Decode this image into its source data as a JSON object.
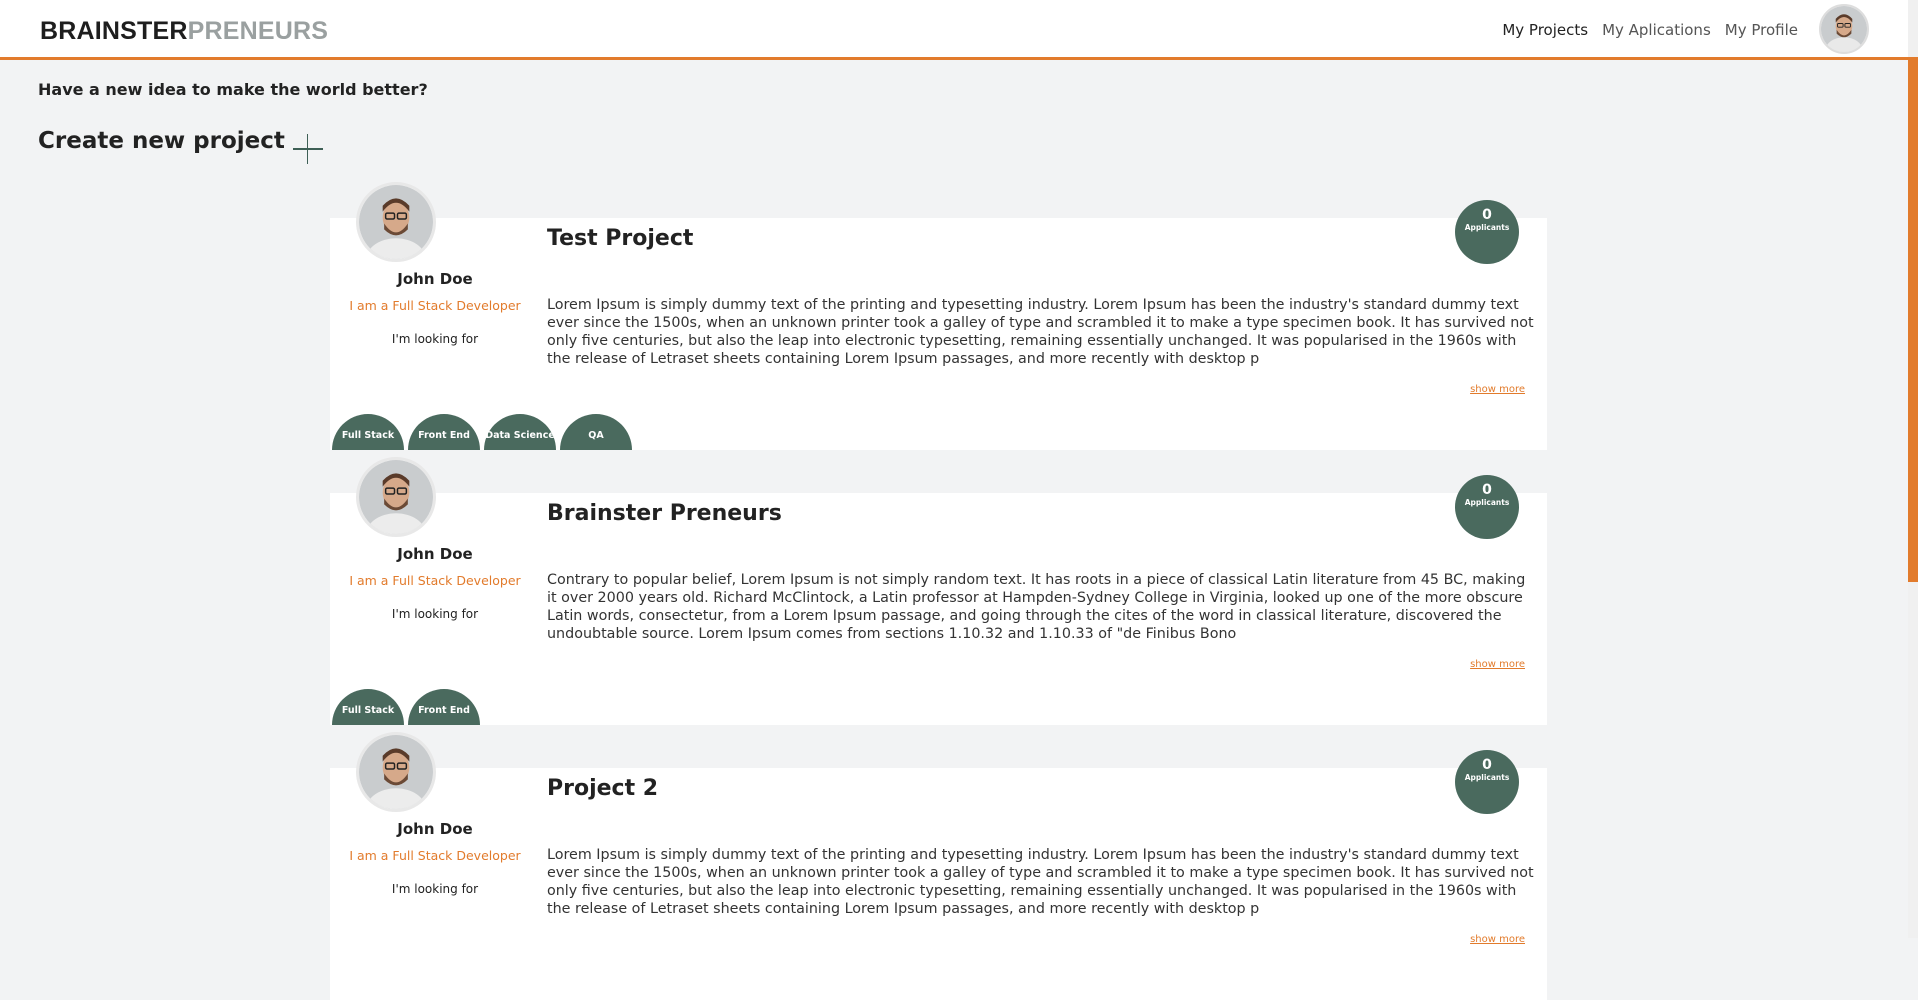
{
  "navbar": {
    "brand_part1": "BRAINSTER",
    "brand_part2": "PRENEURS",
    "links": [
      "My Projects",
      "My Aplications",
      "My Profile"
    ]
  },
  "hero": {
    "idea_text": "Have a new idea to make the world better?",
    "create_label": "Create new project"
  },
  "projects": [
    {
      "author": "John Doe",
      "role": "I am a Full Stack Developer",
      "looking": "I'm looking for",
      "title": "Test Project",
      "description": "Lorem Ipsum is simply dummy text of the printing and typesetting industry. Lorem Ipsum has been the industry's standard dummy text ever since the 1500s, when an unknown printer took a galley of type and scrambled it to make a type specimen book. It has survived not only five centuries, but also the leap into electronic typesetting, remaining essentially unchanged. It was popularised in the 1960s with the release of Letraset sheets containing Lorem Ipsum passages, and more recently with desktop p",
      "show_more": "show more",
      "applicants_count": "0",
      "applicants_label": "Applicants",
      "tags": [
        "Full Stack",
        "Front End",
        "Data Science",
        "QA"
      ]
    },
    {
      "author": "John Doe",
      "role": "I am a Full Stack Developer",
      "looking": "I'm looking for",
      "title": "Brainster Preneurs",
      "description": "Contrary to popular belief, Lorem Ipsum is not simply random text. It has roots in a piece of classical Latin literature from 45 BC, making it over 2000 years old. Richard McClintock, a Latin professor at Hampden-Sydney College in Virginia, looked up one of the more obscure Latin words, consectetur, from a Lorem Ipsum passage, and going through the cites of the word in classical literature, discovered the undoubtable source. Lorem Ipsum comes from sections 1.10.32 and 1.10.33 of \"de Finibus Bono",
      "show_more": "show more",
      "applicants_count": "0",
      "applicants_label": "Applicants",
      "tags": [
        "Full Stack",
        "Front End"
      ]
    },
    {
      "author": "John Doe",
      "role": "I am a Full Stack Developer",
      "looking": "I'm looking for",
      "title": "Project 2",
      "description": "Lorem Ipsum is simply dummy text of the printing and typesetting industry. Lorem Ipsum has been the industry's standard dummy text ever since the 1500s, when an unknown printer took a galley of type and scrambled it to make a type specimen book. It has survived not only five centuries, but also the leap into electronic typesetting, remaining essentially unchanged. It was popularised in the 1960s with the release of Letraset sheets containing Lorem Ipsum passages, and more recently with desktop p",
      "show_more": "show more",
      "applicants_count": "0",
      "applicants_label": "Applicants",
      "tags": []
    }
  ],
  "colors": {
    "accent": "#e27b2c",
    "green": "#4a6a5e"
  }
}
